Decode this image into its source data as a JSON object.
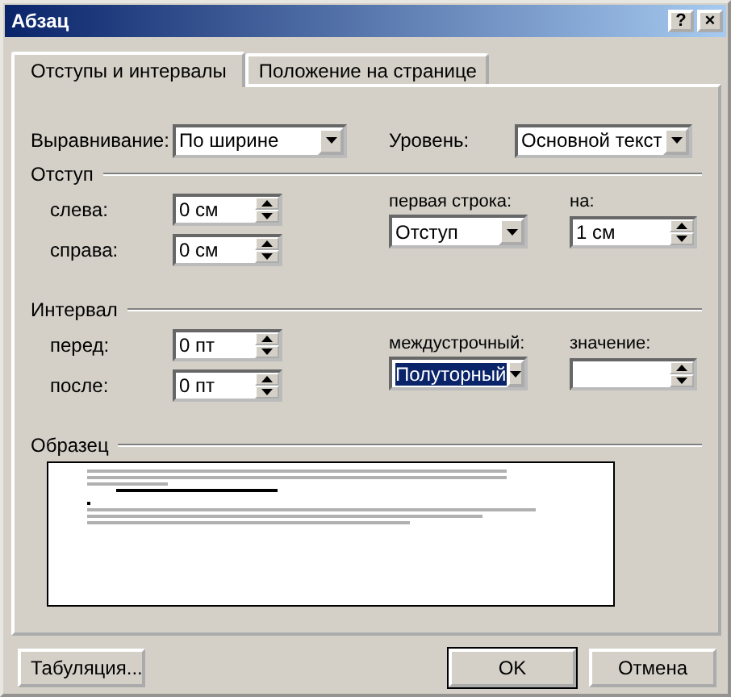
{
  "window": {
    "title": "Абзац",
    "buttons": [
      "?",
      "×"
    ]
  },
  "tabs": [
    {
      "label": "Отступы и интервалы",
      "selected": true
    },
    {
      "label": "Положение на странице",
      "selected": false
    }
  ],
  "general": [
    {
      "label": "Выравнивание:",
      "value": "По ширине"
    },
    {
      "label": "Уровень:",
      "value": "Основной текст"
    }
  ],
  "indent": {
    "title": "Отступ",
    "fields": [
      {
        "label": "слева:",
        "value": "0 см"
      },
      {
        "label": "справа:",
        "value": "0 см"
      }
    ],
    "special": {
      "label": "первая строка:",
      "value": "Отступ",
      "highlighted": false
    },
    "by": {
      "label": "на:",
      "value": "1 см"
    }
  },
  "spacing": {
    "title": "Интервал",
    "fields": [
      {
        "label": "перед:",
        "value": "0 пт"
      },
      {
        "label": "после:",
        "value": "0 пт"
      }
    ],
    "special": {
      "label": "междустрочный:",
      "value": "Полуторный",
      "highlighted": true
    },
    "by": {
      "label": "значение:"
    }
  },
  "preview": {
    "title": "Образец"
  },
  "buttons": [
    "Табуляция...",
    "OK",
    "Отмена"
  ]
}
